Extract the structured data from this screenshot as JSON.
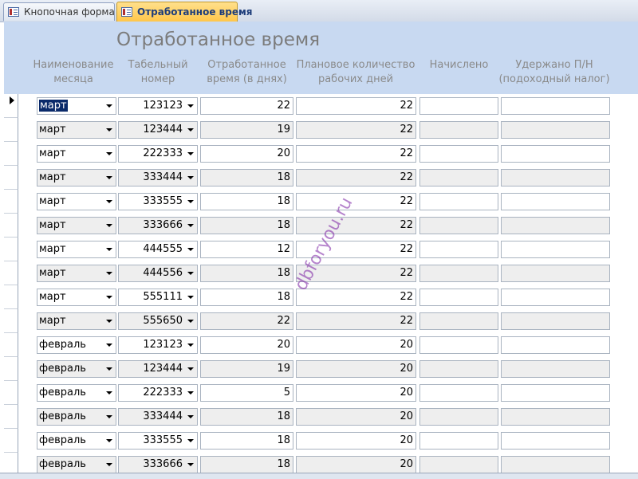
{
  "tabs": [
    {
      "label": "Кнопочная форма",
      "active": false
    },
    {
      "label": "Отработанное время",
      "active": true
    }
  ],
  "form": {
    "title": "Отработанное время",
    "columns": {
      "month": "Наименование месяца",
      "tabnum": "Табельный номер",
      "days": "Отработанное время (в днях)",
      "plan": "Плановое количество рабочих дней",
      "accrued": "Начислено",
      "deducted": "Удержано П/Н (подоходный налог)"
    }
  },
  "rows": [
    {
      "month": "март",
      "tabnum": "123123",
      "days": "22",
      "plan": "22",
      "accrued": "",
      "deducted": ""
    },
    {
      "month": "март",
      "tabnum": "123444",
      "days": "19",
      "plan": "22",
      "accrued": "",
      "deducted": ""
    },
    {
      "month": "март",
      "tabnum": "222333",
      "days": "20",
      "plan": "22",
      "accrued": "",
      "deducted": ""
    },
    {
      "month": "март",
      "tabnum": "333444",
      "days": "18",
      "plan": "22",
      "accrued": "",
      "deducted": ""
    },
    {
      "month": "март",
      "tabnum": "333555",
      "days": "18",
      "plan": "22",
      "accrued": "",
      "deducted": ""
    },
    {
      "month": "март",
      "tabnum": "333666",
      "days": "18",
      "plan": "22",
      "accrued": "",
      "deducted": ""
    },
    {
      "month": "март",
      "tabnum": "444555",
      "days": "12",
      "plan": "22",
      "accrued": "",
      "deducted": ""
    },
    {
      "month": "март",
      "tabnum": "444556",
      "days": "18",
      "plan": "22",
      "accrued": "",
      "deducted": ""
    },
    {
      "month": "март",
      "tabnum": "555111",
      "days": "18",
      "plan": "22",
      "accrued": "",
      "deducted": ""
    },
    {
      "month": "март",
      "tabnum": "555650",
      "days": "22",
      "plan": "22",
      "accrued": "",
      "deducted": ""
    },
    {
      "month": "февраль",
      "tabnum": "123123",
      "days": "20",
      "plan": "20",
      "accrued": "",
      "deducted": ""
    },
    {
      "month": "февраль",
      "tabnum": "123444",
      "days": "19",
      "plan": "20",
      "accrued": "",
      "deducted": ""
    },
    {
      "month": "февраль",
      "tabnum": "222333",
      "days": "5",
      "plan": "20",
      "accrued": "",
      "deducted": ""
    },
    {
      "month": "февраль",
      "tabnum": "333444",
      "days": "18",
      "plan": "20",
      "accrued": "",
      "deducted": ""
    },
    {
      "month": "февраль",
      "tabnum": "333555",
      "days": "18",
      "plan": "20",
      "accrued": "",
      "deducted": ""
    },
    {
      "month": "февраль",
      "tabnum": "333666",
      "days": "18",
      "plan": "20",
      "accrued": "",
      "deducted": ""
    }
  ],
  "watermark": "dbforyou.ru",
  "colors": {
    "header": "#c8d9f1",
    "active_tab": "#ffc64a",
    "alt_row": "#eeeeee"
  }
}
